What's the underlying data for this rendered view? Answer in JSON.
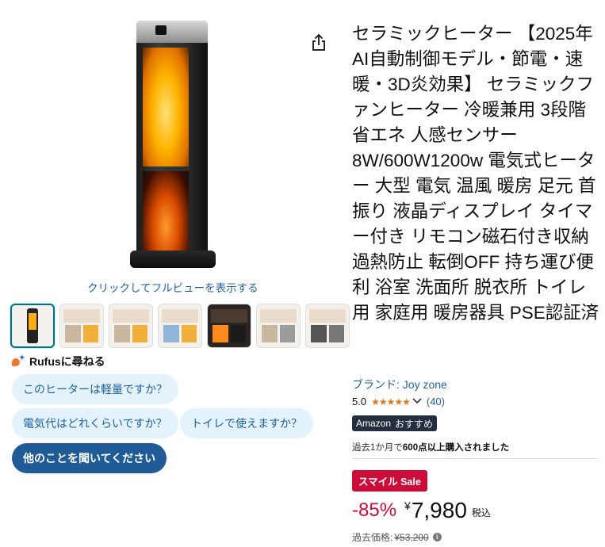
{
  "image_section": {
    "fullview_label": "クリックしてフルビューを表示する",
    "thumbnail_count": 7,
    "selected_thumbnail": 1
  },
  "rufus": {
    "title": "Rufusに尋ねる",
    "chips": [
      "このヒーターは軽量ですか？",
      "電気代はどれくらいですか？",
      "トイレで使えますか？"
    ],
    "ask_more": "他のことを聞いてください"
  },
  "product": {
    "title": "セラミックヒーター 【2025年AI自動制御モデル・節電・速暖・3D炎効果】 セラミックファンヒーター 冷暖兼用 3段階 省エネ 人感センサー 8W/600W1200w 電気式ヒーター 大型 電気 温風 暖房 足元 首振り 液晶ディスプレイ タイマー付き リモコン磁石付き収納 過熱防止 転倒OFF 持ち運び便利 浴室 洗面所 脱衣所 トイレ用 家庭用 暖房器具 PSE認証済",
    "brand": "ブランド: Joy zone",
    "rating": "5.0",
    "stars": "★★★★★",
    "review_count": "(40)",
    "badge_main": "Amazon",
    "badge_sub": "おすすめ",
    "bought_prefix": "過去1か月で",
    "bought_bold": "600点以上購入されました",
    "sale_label": "スマイル Sale",
    "discount": "-85%",
    "currency": "¥",
    "price": "7,980",
    "tax": "税込",
    "list_price_label": "過去価格:",
    "list_price": "¥53,200"
  },
  "colors": {
    "link": "#2162a1",
    "sale": "#cc0c39",
    "star": "#de7921",
    "chip_bg": "#e3f2fb",
    "chip_dark": "#1f5c97"
  }
}
